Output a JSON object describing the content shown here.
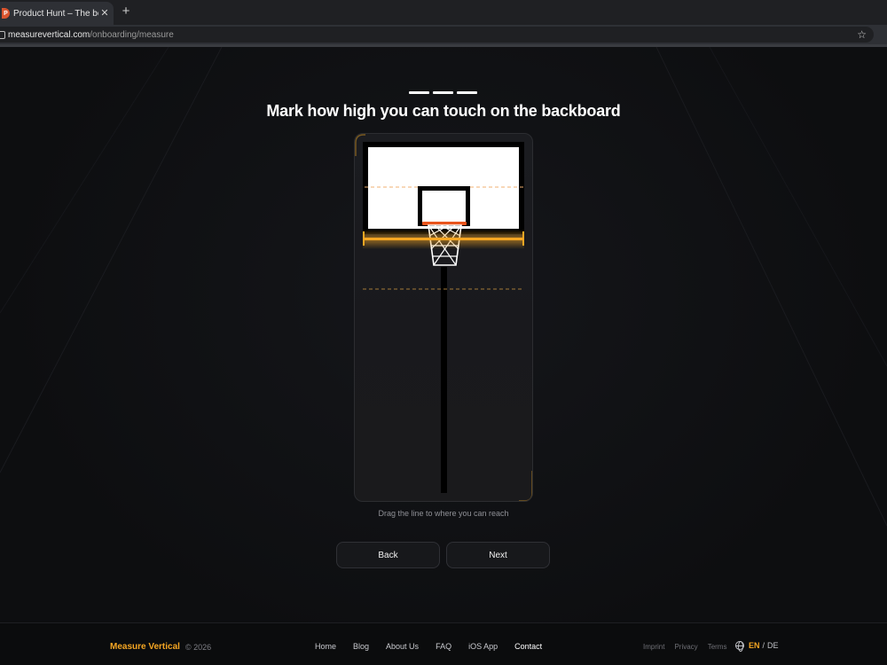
{
  "browser": {
    "tab_title": "Product Hunt – The best n",
    "tab_favicon": "P",
    "tab_close": "✕",
    "new_tab": "+",
    "url_host": "measurevertical.com",
    "url_path": "/onboarding/measure",
    "bookmark_icon": "☆"
  },
  "onboarding": {
    "headline": "Mark how high you can touch on the backboard",
    "steps_total": 3,
    "hint": "Drag the line to where you can reach",
    "back_label": "Back",
    "next_label": "Next"
  },
  "footer": {
    "brand": "Measure Vertical",
    "copyright": "© 2026",
    "nav": [
      "Home",
      "Blog",
      "About Us",
      "FAQ",
      "iOS App",
      "Contact"
    ],
    "legal": [
      "Imprint",
      "Privacy",
      "Terms"
    ],
    "lang_active": "EN",
    "lang_sep": "/",
    "lang_other": "DE"
  },
  "colors": {
    "accent": "#f5a623",
    "rim": "#e8541c",
    "background": "#0c0d0f"
  }
}
